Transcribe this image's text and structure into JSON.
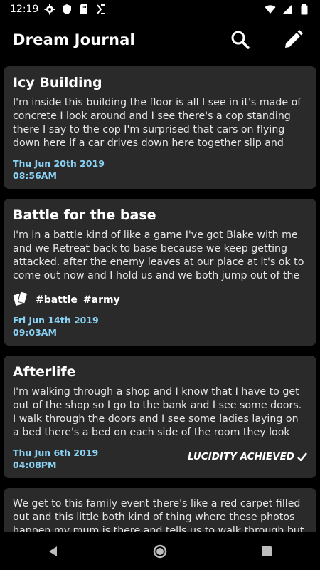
{
  "status_bar": {
    "time": "12:19"
  },
  "app_bar": {
    "title": "Dream Journal"
  },
  "entries": [
    {
      "title": "Icy Building",
      "body": "I'm inside this building the floor is all I see in it's made of concrete I look around and I see there's a cop standing there I say to the cop I'm surprised that cars on flying down here if a car drives down here together slip and crash. I then see",
      "date": "Thu Jun 20th 2019",
      "time": "08:56AM"
    },
    {
      "title": "Battle for the base",
      "body": "I'm in a battle kind of like a game I've got Blake with me and we Retreat back to base because we keep getting attacked. after the enemy leaves at our place at it's ok to come out now and I hold us and we both jump out of the place and",
      "tags": [
        "#battle",
        "#army"
      ],
      "date": "Fri Jun 14th 2019",
      "time": "09:03AM"
    },
    {
      "title": "Afterlife",
      "body": "I'm walking through a shop and I know that I have to get out of the shop so I go to the bank and I see some doors. I walk through the doors and I see some ladies laying on a bed there's a bed on each side of the room they look like they're",
      "date": "Thu Jun 6th 2019",
      "time": "04:08PM",
      "badge": "LUCIDITY ACHIEVED"
    },
    {
      "body": "We get to this family event there's like a red carpet filled out and this little both kind of thing where these photos happen my mum is there and tells us to walk through but I don't want"
    }
  ],
  "colors": {
    "background": "#000000",
    "card": "#2a2a2a",
    "date_accent": "#8ad2f5"
  },
  "icons": {
    "search": "search-icon",
    "edit": "pencil-icon",
    "tag_group": "cards-icon"
  }
}
